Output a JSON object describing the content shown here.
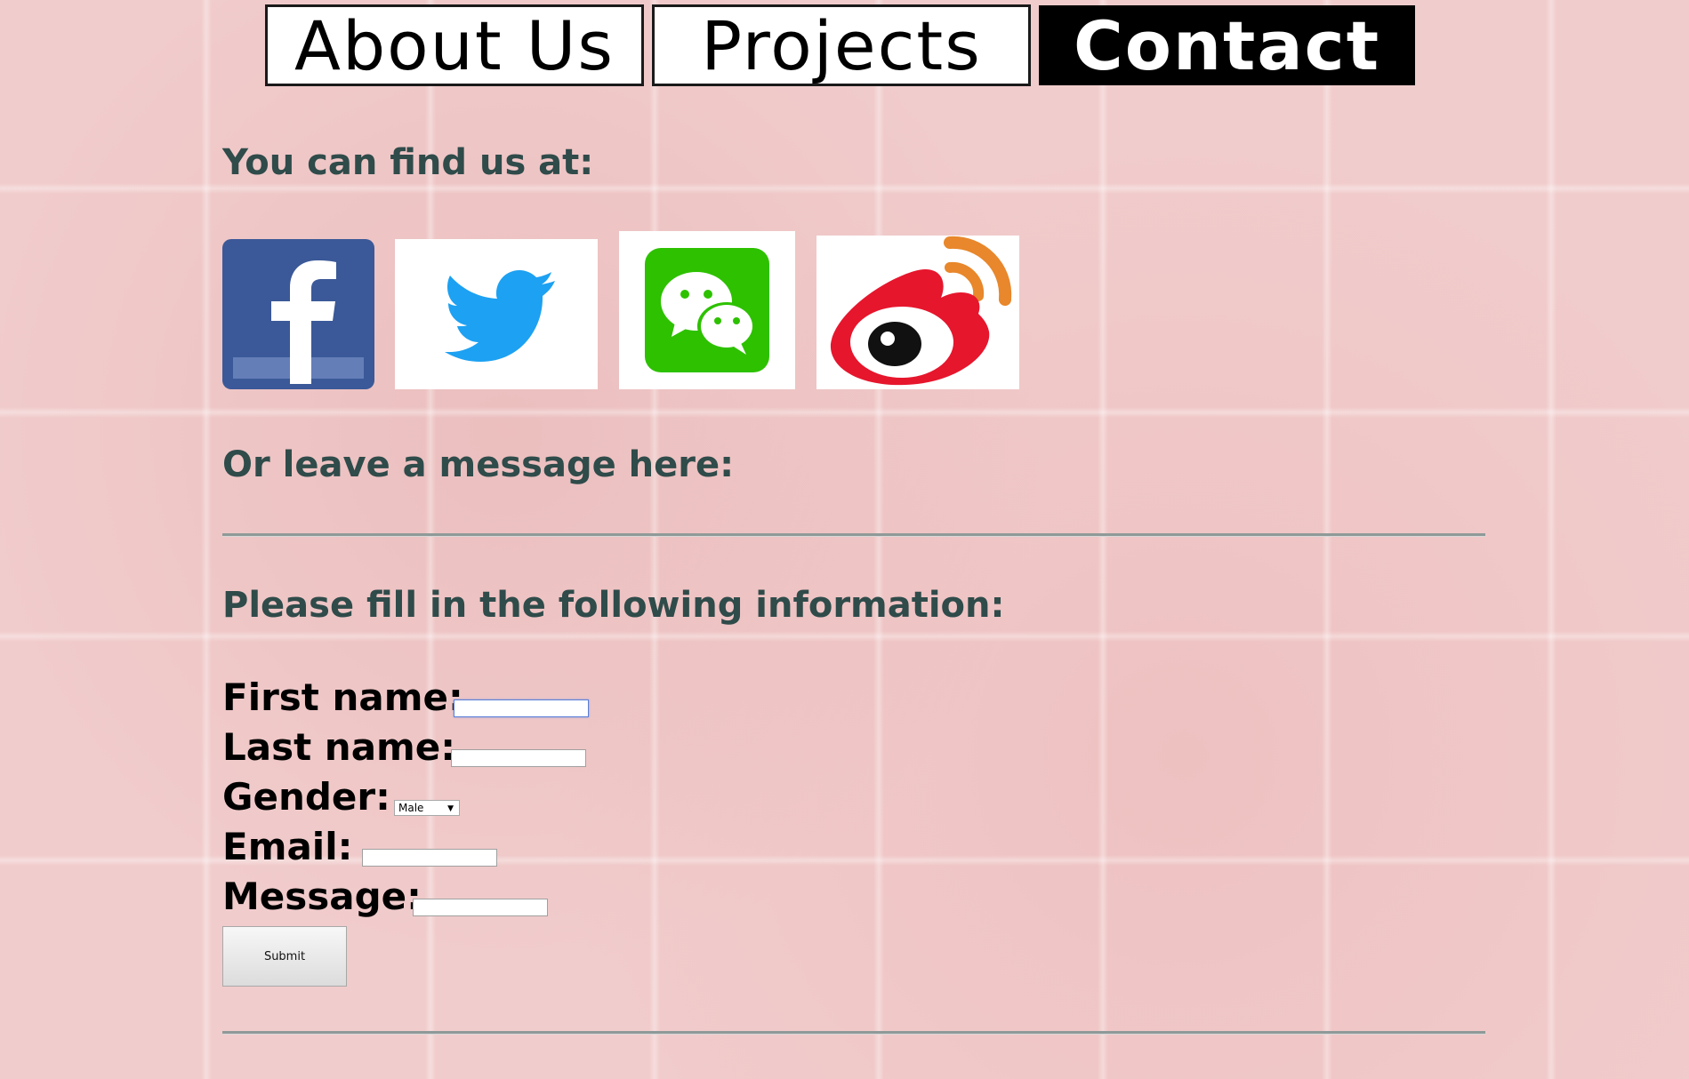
{
  "nav": {
    "about_label": "About Us",
    "projects_label": "Projects",
    "contact_label": "Contact"
  },
  "headings": {
    "find_us": "You can find us at:",
    "leave_message": "Or leave a message here:",
    "fill_info": "Please fill in the following information:"
  },
  "social": [
    {
      "name": "facebook-icon",
      "color": "#3b5998"
    },
    {
      "name": "twitter-icon",
      "color": "#1da1f2"
    },
    {
      "name": "wechat-icon",
      "color": "#2dc100"
    },
    {
      "name": "weibo-icon",
      "color": "#e6162d"
    }
  ],
  "form": {
    "first_name_label": "First name:",
    "last_name_label": "Last name:",
    "gender_label": "Gender:",
    "gender_value": "Male",
    "email_label": "Email:",
    "message_label": "Message:",
    "submit_label": "Submit"
  },
  "colors": {
    "background": "#f1cccc",
    "heading": "#2f4b4a"
  }
}
